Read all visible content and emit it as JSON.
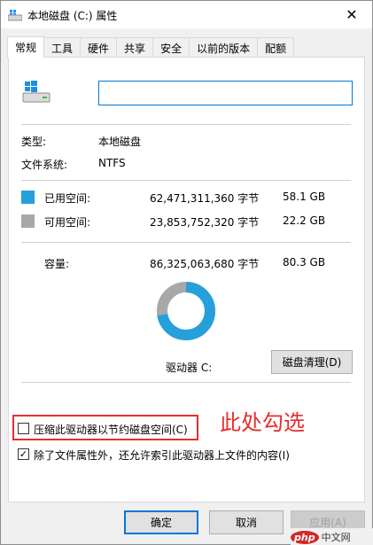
{
  "window": {
    "title": "本地磁盘 (C:) 属性",
    "close_glyph": "✕"
  },
  "tabs": [
    {
      "label": "常规",
      "active": true
    },
    {
      "label": "工具",
      "active": false
    },
    {
      "label": "硬件",
      "active": false
    },
    {
      "label": "共享",
      "active": false
    },
    {
      "label": "安全",
      "active": false
    },
    {
      "label": "以前的版本",
      "active": false
    },
    {
      "label": "配额",
      "active": false
    }
  ],
  "general": {
    "name_value": "",
    "type_label": "类型:",
    "type_value": "本地磁盘",
    "fs_label": "文件系统:",
    "fs_value": "NTFS",
    "used": {
      "label": "已用空间:",
      "bytes": "62,471,311,360 字节",
      "size": "58.1 GB",
      "color": "#26a0da"
    },
    "free": {
      "label": "可用空间:",
      "bytes": "23,853,752,320 字节",
      "size": "22.2 GB",
      "color": "#a8a8a8"
    },
    "capacity": {
      "label": "容量:",
      "bytes": "86,325,063,680 字节",
      "size": "80.3 GB"
    },
    "used_fraction": 0.7237,
    "drive_label": "驱动器 C:",
    "cleanup_button": "磁盘清理(D)",
    "compress_checkbox": {
      "label": "压缩此驱动器以节约磁盘空间(C)",
      "checked": false
    },
    "index_checkbox": {
      "label": "除了文件属性外，还允许索引此驱动器上文件的内容(I)",
      "checked": true
    },
    "checkmark_glyph": "✓"
  },
  "annotation": {
    "text": "此处勾选",
    "color": "#e62e2e"
  },
  "buttons": {
    "ok": "确定",
    "cancel": "取消",
    "apply": "应用(A)"
  },
  "watermark": {
    "badge": "php",
    "text": "中文网"
  }
}
